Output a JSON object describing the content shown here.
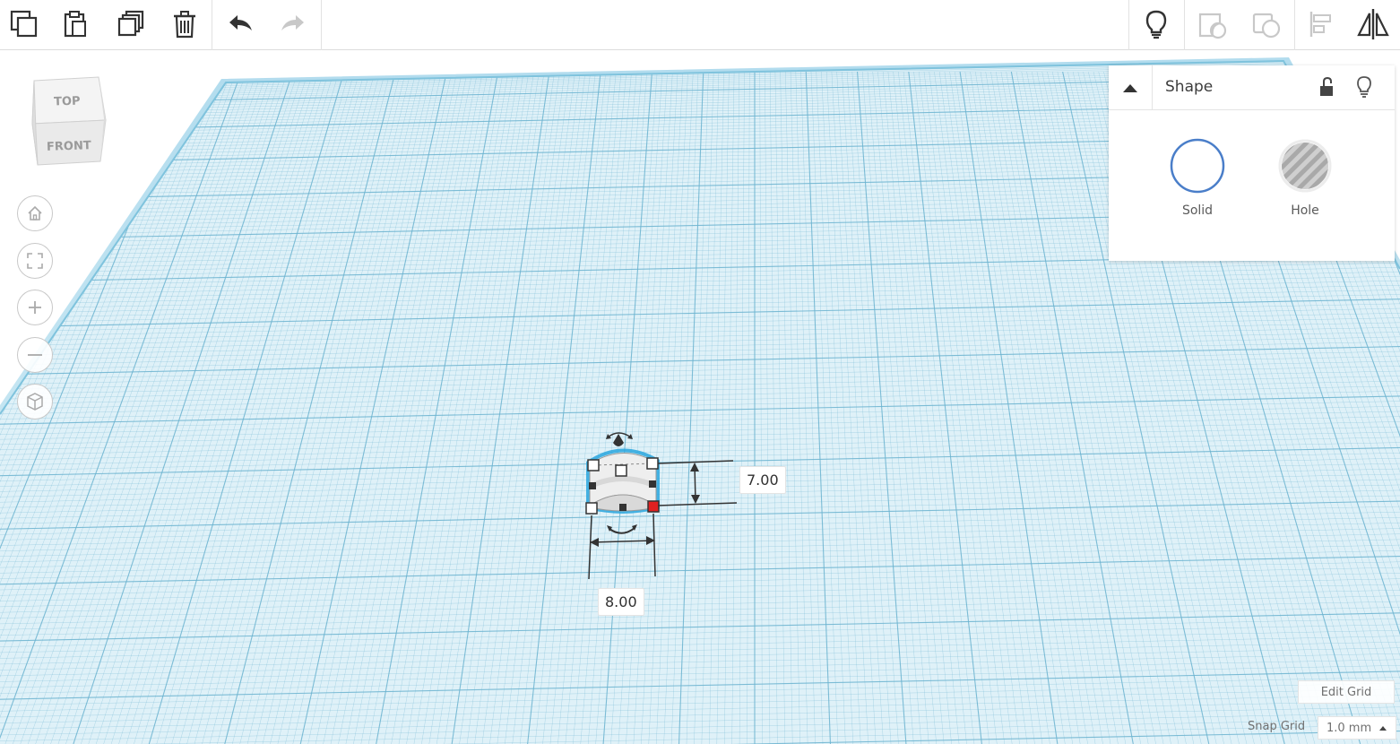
{
  "toolbar": {
    "left_tools": [
      "copy-icon",
      "paste-icon",
      "duplicate-icon",
      "delete-icon",
      "undo-icon",
      "redo-icon"
    ],
    "right_tools": [
      "lightbulb-icon",
      "group-icon",
      "ungroup-icon",
      "align-icon",
      "mirror-icon"
    ]
  },
  "viewcube": {
    "top_label": "TOP",
    "front_label": "FRONT"
  },
  "nav": [
    "home-icon",
    "fit-view-icon",
    "zoom-in-icon",
    "zoom-out-icon",
    "perspective-icon"
  ],
  "shape_panel": {
    "title": "Shape",
    "solid_label": "Solid",
    "hole_label": "Hole",
    "solid_color": "#4a7ec9"
  },
  "selection": {
    "height_value": "7.00",
    "width_value": "8.00"
  },
  "grid": {
    "edit_label": "Edit Grid",
    "snap_label": "Snap Grid",
    "snap_value": "1.0 mm"
  },
  "colors": {
    "grid_fill": "#d8eef7",
    "grid_line": "#6bb3d0",
    "selection_outline": "#29a6de",
    "active_handle": "#e02020"
  }
}
